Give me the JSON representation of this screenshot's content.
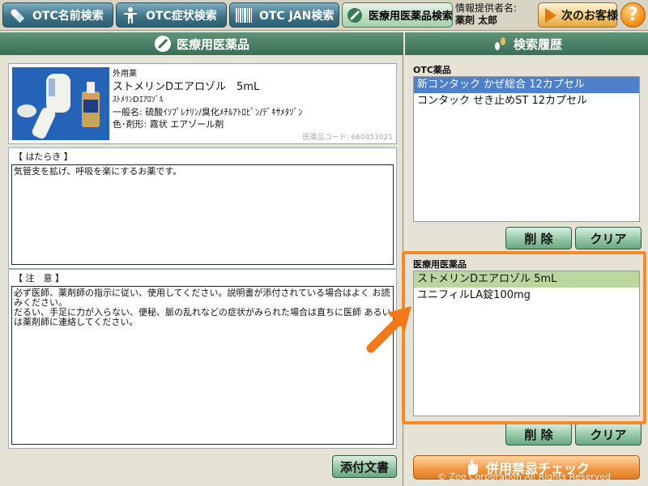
{
  "nav": {
    "otc_name_search": "OTC名前検索",
    "otc_symptom_search": "OTC症状検索",
    "otc_jan_search": "OTC JAN検索",
    "rx_search": "医療用医薬品検索"
  },
  "provider": {
    "label": "情報提供者名:",
    "name": "薬剤 太郎"
  },
  "next_customer": "次のお客様",
  "help": "?",
  "left_header": "医療用医薬品",
  "right_header": "検索履歴",
  "drug": {
    "category": "外用薬",
    "name": "ストメリンDエアロゾル　5mL",
    "kana": "ｽﾄﾒﾘﾝDｴｱﾛｿﾞﾙ",
    "generic": "一般名:  硫酸ｲｿﾌﾟﾚﾅﾘﾝ/臭化ﾒﾁﾙｱﾄﾛﾋﾟﾝ/ﾃﾞｷｻﾒﾀｿﾞﾝ",
    "form": "色･剤形:  霧状  エアゾール剤",
    "code": "医薬品コード:  660453021"
  },
  "action": {
    "title": "【 はたらき 】",
    "text": "気管支を拡げ、呼吸を楽にするお薬です。"
  },
  "caution": {
    "title": "【 注　意 】",
    "text": "必ず医師、薬剤師の指示に従い、使用してください。説明書が添付されている場合はよく お読みください。\nだるい、手足に力が入らない、便秘、脈の乱れなどの症状がみられた場合は直ちに医師 あるいは薬剤師に連絡してください。"
  },
  "attach_doc": "添付文書",
  "otc_history": {
    "label": "OTC薬品",
    "items": [
      "新コンタック かぜ総合 12カプセル",
      "コンタック せき止めST 12カプセル"
    ]
  },
  "rx_history": {
    "label": "医療用医薬品",
    "items": [
      "ストメリンDエアロゾル 5mL",
      "ユニフィルLA錠100mg"
    ]
  },
  "delete_label": "削 除",
  "clear_label": "クリア",
  "interaction_check": "併用禁忌チェック",
  "copyright": "© Zoo Corporation All Rights Reserved"
}
